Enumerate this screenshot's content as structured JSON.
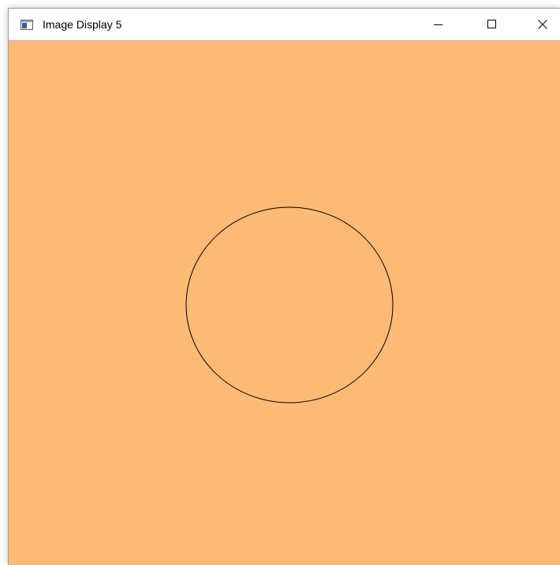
{
  "window": {
    "title": "Image Display 5",
    "icons": {
      "app": "image-window-icon",
      "minimize": "minimize-icon",
      "maximize": "maximize-icon",
      "close": "close-icon"
    }
  },
  "canvas": {
    "background_color": "#FDBA74",
    "circle_stroke_color": "#000000",
    "shape": "circle-outline"
  }
}
